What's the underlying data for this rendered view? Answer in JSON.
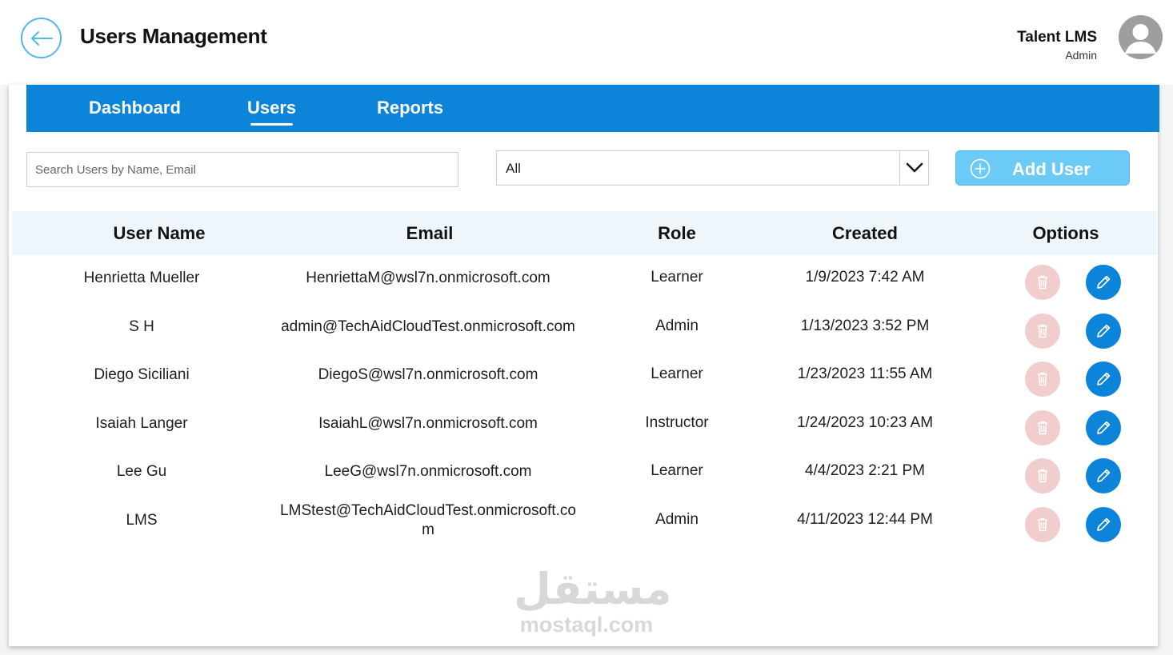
{
  "header": {
    "title": "Users Management",
    "user_name": "Talent LMS",
    "user_role": "Admin"
  },
  "nav": {
    "items": [
      {
        "label": "Dashboard",
        "active": false
      },
      {
        "label": "Users",
        "active": true
      },
      {
        "label": "Reports",
        "active": false
      }
    ]
  },
  "controls": {
    "search_placeholder": "Search Users by Name, Email",
    "search_value": "",
    "role_filter_value": "All",
    "add_user_label": "Add User"
  },
  "table": {
    "columns": [
      "User Name",
      "Email",
      "Role",
      "Created",
      "Options"
    ],
    "rows": [
      {
        "name": "Henrietta Mueller",
        "email": "HenriettaM@wsl7n.onmicrosoft.com",
        "role": "Learner",
        "created": "1/9/2023 7:42 AM"
      },
      {
        "name": "S H",
        "email": "admin@TechAidCloudTest.onmicrosoft.com",
        "role": "Admin",
        "created": "1/13/2023 3:52 PM"
      },
      {
        "name": "Diego Siciliani",
        "email": "DiegoS@wsl7n.onmicrosoft.com",
        "role": "Learner",
        "created": "1/23/2023 11:55 AM"
      },
      {
        "name": "Isaiah Langer",
        "email": "IsaiahL@wsl7n.onmicrosoft.com",
        "role": "Instructor",
        "created": "1/24/2023 10:23 AM"
      },
      {
        "name": "Lee Gu",
        "email": "LeeG@wsl7n.onmicrosoft.com",
        "role": "Learner",
        "created": "4/4/2023 2:21 PM"
      },
      {
        "name": "LMS",
        "email": "LMStest@TechAidCloudTest.onmicrosoft.com",
        "role": "Admin",
        "created": "4/11/2023 12:44 PM"
      }
    ]
  },
  "watermark": {
    "arabic": "مستقل",
    "latin": "mostaql.com"
  },
  "colors": {
    "brand_blue": "#0b84d9",
    "accent_light_blue": "#6ccaf6",
    "delete_disabled": "#f2cdcd",
    "header_row_bg": "#eef6fc"
  },
  "icons": {
    "back": "arrow-left-icon",
    "avatar": "user-avatar-icon",
    "chevron": "chevron-down-icon",
    "add": "plus-circle-icon",
    "delete": "trash-icon",
    "edit": "pencil-icon"
  }
}
